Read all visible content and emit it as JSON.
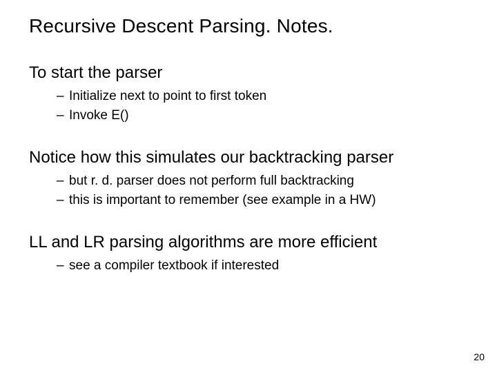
{
  "title": "Recursive Descent Parsing. Notes.",
  "sections": [
    {
      "head": "To start the parser",
      "items": [
        "Initialize next to point to first token",
        "Invoke E()"
      ]
    },
    {
      "head": "Notice how this simulates our backtracking parser",
      "items": [
        "but r. d. parser does not perform full backtracking",
        "this is important to remember (see example in a HW)"
      ]
    },
    {
      "head": "LL and LR parsing algorithms are more efficient",
      "items": [
        "see a compiler textbook if interested"
      ]
    }
  ],
  "page_number": "20"
}
